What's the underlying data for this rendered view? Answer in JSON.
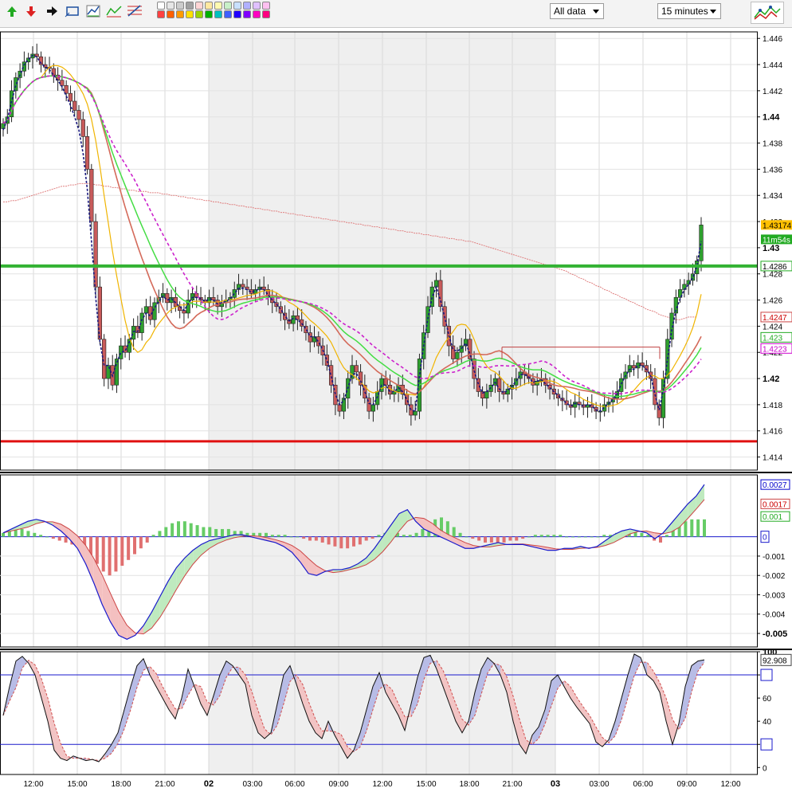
{
  "toolbar": {
    "range_select": "All data",
    "interval_select": "15 minutes",
    "swatch_colors": [
      "#ffffff",
      "#e6e6e6",
      "#cccccc",
      "#a0a0a0",
      "#ffd5d5",
      "#ffe8a0",
      "#fffab0",
      "#c8f0c8",
      "#c8e0ff",
      "#b0b0ff",
      "#e0c0ff",
      "#ffc0f0",
      "#ff4040",
      "#ff6000",
      "#ff9a00",
      "#ffe000",
      "#9ad400",
      "#00b000",
      "#00c0c0",
      "#4060ff",
      "#2000ff",
      "#8000ff",
      "#ff00c0",
      "#ff0080"
    ]
  },
  "chart_data": {
    "type": "candlestick",
    "x_ticks": [
      "12:00",
      "15:00",
      "18:00",
      "21:00",
      "02",
      "03:00",
      "06:00",
      "09:00",
      "12:00",
      "15:00",
      "18:00",
      "21:00",
      "03",
      "03:00",
      "06:00",
      "09:00",
      "12:00"
    ],
    "price": {
      "ylim": [
        1.413,
        1.4465
      ],
      "ticks": [
        "1.446",
        "1.444",
        "1.442",
        "1.44",
        "1.438",
        "1.436",
        "1.434",
        "1.432",
        "1.43",
        "1.428",
        "1.426",
        "1.424",
        "1.422",
        "1.42",
        "1.418",
        "1.416",
        "1.414"
      ],
      "bold_ticks": [
        "1.44",
        "1.43",
        "1.42"
      ],
      "close": [
        1.4395,
        1.44,
        1.442,
        1.443,
        1.4435,
        1.4442,
        1.4445,
        1.4448,
        1.4446,
        1.444,
        1.4438,
        1.4437,
        1.4432,
        1.4428,
        1.4424,
        1.4418,
        1.4412,
        1.4405,
        1.4398,
        1.4385,
        1.436,
        1.432,
        1.427,
        1.423,
        1.42,
        1.421,
        1.4195,
        1.4215,
        1.4225,
        1.422,
        1.423,
        1.424,
        1.4235,
        1.425,
        1.4255,
        1.4245,
        1.4258,
        1.4262,
        1.4265,
        1.4258,
        1.4262,
        1.4255,
        1.4252,
        1.425,
        1.426,
        1.4265,
        1.4262,
        1.426,
        1.4258,
        1.4262,
        1.426,
        1.4255,
        1.4258,
        1.426,
        1.4262,
        1.4268,
        1.4272,
        1.427,
        1.4268,
        1.4265,
        1.4268,
        1.427,
        1.4268,
        1.4262,
        1.4258,
        1.4255,
        1.425,
        1.4245,
        1.4242,
        1.4248,
        1.4245,
        1.424,
        1.4235,
        1.4228,
        1.4232,
        1.4225,
        1.4218,
        1.421,
        1.4195,
        1.418,
        1.4175,
        1.4185,
        1.42,
        1.421,
        1.4205,
        1.4195,
        1.4185,
        1.4175,
        1.418,
        1.419,
        1.42,
        1.4195,
        1.4188,
        1.419,
        1.4195,
        1.4188,
        1.418,
        1.4172,
        1.4175,
        1.4215,
        1.4235,
        1.4255,
        1.427,
        1.4275,
        1.4255,
        1.424,
        1.4225,
        1.4215,
        1.422,
        1.4225,
        1.423,
        1.4215,
        1.42,
        1.419,
        1.4185,
        1.419,
        1.4195,
        1.42,
        1.419,
        1.4188,
        1.4192,
        1.4195,
        1.42,
        1.4205,
        1.4203,
        1.42,
        1.4195,
        1.4198,
        1.42,
        1.4195,
        1.4192,
        1.4188,
        1.4185,
        1.4183,
        1.418,
        1.4178,
        1.4182,
        1.418,
        1.4178,
        1.418,
        1.4178,
        1.4175,
        1.4175,
        1.418,
        1.4182,
        1.4185,
        1.419,
        1.42,
        1.4205,
        1.421,
        1.4208,
        1.4212,
        1.421,
        1.4205,
        1.42,
        1.418,
        1.417,
        1.42,
        1.423,
        1.425,
        1.4262,
        1.4268,
        1.4272,
        1.4275,
        1.428,
        1.429,
        1.43174
      ],
      "ema_fast": [
        1.439,
        1.4398,
        1.4412,
        1.4424,
        1.4432,
        1.444,
        1.4444,
        1.4447,
        1.4446,
        1.4441,
        1.4438,
        1.4436,
        1.4432,
        1.4428,
        1.4423,
        1.4416,
        1.4409,
        1.44,
        1.439,
        1.4372,
        1.4345,
        1.4305,
        1.4262,
        1.4228,
        1.421,
        1.421,
        1.4202,
        1.4212,
        1.422,
        1.4221,
        1.4228,
        1.4236,
        1.4236,
        1.4245,
        1.425,
        1.4248,
        1.4254,
        1.4259,
        1.4263,
        1.426,
        1.4261,
        1.4258,
        1.4255,
        1.4252,
        1.4257,
        1.4262,
        1.4262,
        1.4261,
        1.4259,
        1.4261,
        1.426,
        1.4257,
        1.4258,
        1.4259,
        1.4261,
        1.4265,
        1.4269,
        1.4269,
        1.4268,
        1.4266,
        1.4267,
        1.4269,
        1.4268,
        1.4264,
        1.426,
        1.4257,
        1.4253,
        1.4248,
        1.4244,
        1.4246,
        1.4245,
        1.4242,
        1.4238,
        1.4232,
        1.4232,
        1.4228,
        1.4222,
        1.4214,
        1.4202,
        1.4188,
        1.418,
        1.4183,
        1.4193,
        1.4203,
        1.4204,
        1.4198,
        1.419,
        1.4181,
        1.418,
        1.4186,
        1.4195,
        1.4195,
        1.419,
        1.419,
        1.4193,
        1.419,
        1.4184,
        1.4176,
        1.4175,
        1.4202,
        1.4225,
        1.4246,
        1.4262,
        1.427,
        1.426,
        1.4247,
        1.4233,
        1.4222,
        1.4221,
        1.4223,
        1.4227,
        1.4219,
        1.4206,
        1.4196,
        1.4189,
        1.419,
        1.4193,
        1.4197,
        1.4192,
        1.4189,
        1.4191,
        1.4194,
        1.4198,
        1.4203,
        1.4203,
        1.4201,
        1.4197,
        1.4198,
        1.4199,
        1.4196,
        1.4193,
        1.419,
        1.4187,
        1.4184,
        1.4181,
        1.4179,
        1.4181,
        1.418,
        1.4179,
        1.418,
        1.4179,
        1.4176,
        1.4175,
        1.4178,
        1.4181,
        1.4184,
        1.4188,
        1.4196,
        1.4202,
        1.4207,
        1.4207,
        1.421,
        1.421,
        1.4207,
        1.4202,
        1.4188,
        1.4176,
        1.4191,
        1.4215,
        1.4237,
        1.4252,
        1.4261,
        1.4268,
        1.4272,
        1.4277,
        1.4286,
        1.4305
      ],
      "sma_long": [
        1.4335,
        1.4335,
        1.4336,
        1.4336,
        1.4337,
        1.4338,
        1.4339,
        1.434,
        1.4341,
        1.4342,
        1.4343,
        1.4344,
        1.4345,
        1.4346,
        1.4347,
        1.4347,
        1.4348,
        1.4348,
        1.4349,
        1.4349,
        1.4349,
        1.4349,
        1.4348,
        1.4348,
        1.4347,
        1.4347,
        1.4346,
        1.4346,
        1.4345,
        1.4345,
        1.4344,
        1.4344,
        1.4343,
        1.4343,
        1.4343,
        1.4342,
        1.4342,
        1.4342,
        1.4341,
        1.4341,
        1.434,
        1.434,
        1.4339,
        1.4339,
        1.4338,
        1.4338,
        1.4337,
        1.4337,
        1.4336,
        1.4336,
        1.4335,
        1.4335,
        1.4334,
        1.4334,
        1.4333,
        1.4333,
        1.4332,
        1.4332,
        1.4331,
        1.4331,
        1.433,
        1.433,
        1.4329,
        1.4329,
        1.4328,
        1.4328,
        1.4327,
        1.4327,
        1.4326,
        1.4326,
        1.4325,
        1.4325,
        1.4324,
        1.4324,
        1.4323,
        1.4323,
        1.4322,
        1.4322,
        1.4321,
        1.4321,
        1.432,
        1.432,
        1.4319,
        1.4319,
        1.4318,
        1.4318,
        1.4317,
        1.4317,
        1.4316,
        1.4316,
        1.4315,
        1.4315,
        1.4314,
        1.4314,
        1.4313,
        1.4313,
        1.4312,
        1.4312,
        1.4311,
        1.4311,
        1.431,
        1.431,
        1.4309,
        1.4309,
        1.4308,
        1.4308,
        1.4307,
        1.4307,
        1.4306,
        1.4306,
        1.4305,
        1.4305,
        1.4304,
        1.4303,
        1.4302,
        1.4301,
        1.43,
        1.4299,
        1.4298,
        1.4297,
        1.4296,
        1.4295,
        1.4294,
        1.4293,
        1.4292,
        1.4291,
        1.429,
        1.4289,
        1.4288,
        1.4287,
        1.4286,
        1.4285,
        1.4284,
        1.4283,
        1.4282,
        1.428,
        1.4279,
        1.4277,
        1.4276,
        1.4274,
        1.4273,
        1.4271,
        1.427,
        1.4268,
        1.4267,
        1.4265,
        1.4264,
        1.4262,
        1.4261,
        1.4259,
        1.4258,
        1.4256,
        1.4255,
        1.4253,
        1.4252,
        1.4251,
        1.4249,
        1.4248,
        1.4247,
        1.4246,
        1.4245,
        1.4245,
        1.4246,
        1.4247,
        1.4247,
        1.4247
      ],
      "support_level": 1.4152,
      "resistance_level": 1.4286,
      "price_tags": [
        {
          "label": "1.43174",
          "bg": "#ffc000",
          "fg": "#000000",
          "v": 1.43174
        },
        {
          "label": "11m54s",
          "bg": "#22aa22",
          "fg": "#ffffff",
          "v": 1.43064
        },
        {
          "label": "1.4286",
          "bg": "#ffffff",
          "fg": "#000000",
          "border": "#22aa22",
          "v": 1.4286
        },
        {
          "label": "1.4247",
          "bg": "#ffffff",
          "fg": "#cc0000",
          "border": "#cc4444",
          "v": 1.4247
        },
        {
          "label": "1.423",
          "bg": "#ffffff",
          "fg": "#22aa22",
          "border": "#22aa22",
          "v": 1.42315
        },
        {
          "label": "1.4223",
          "bg": "#ffffff",
          "fg": "#cc00cc",
          "border": "#cc00cc",
          "v": 1.4223
        }
      ]
    },
    "macd": {
      "ylim": [
        -0.0057,
        0.0032
      ],
      "ticks": [
        "-0.001",
        "-0.002",
        "-0.003",
        "-0.004",
        "-0.005"
      ],
      "bold_ticks": [
        "-0.005"
      ],
      "zero_label": "0",
      "tags": [
        {
          "label": "0.0027",
          "fg": "#0000cc",
          "border": "#0000cc",
          "v": 0.0027
        },
        {
          "label": "0.0017",
          "fg": "#cc0000",
          "border": "#cc4444",
          "v": 0.0017
        },
        {
          "label": "0.001",
          "fg": "#22aa22",
          "border": "#22aa22",
          "v": 0.00105
        }
      ],
      "hist": [
        0.0002,
        0.0003,
        0.0004,
        0.0004,
        0.0003,
        0.0002,
        0.0001,
        0,
        -0.0001,
        -0.0002,
        -0.0003,
        -0.0004,
        -0.0005,
        -0.0007,
        -0.001,
        -0.0014,
        -0.0018,
        -0.002,
        -0.0018,
        -0.0015,
        -0.0012,
        -0.0009,
        -0.0006,
        -0.0003,
        0.0001,
        0.0003,
        0.0005,
        0.0007,
        0.0008,
        0.0008,
        0.0007,
        0.0006,
        0.0005,
        0.0005,
        0.0004,
        0.0004,
        0.0004,
        0.0003,
        0.0003,
        0.0002,
        0.0002,
        0.0002,
        0.0002,
        0.0001,
        0.0001,
        0.0001,
        0,
        0,
        -0.0001,
        -0.0002,
        -0.0002,
        -0.0003,
        -0.0004,
        -0.0005,
        -0.0006,
        -0.0006,
        -0.0005,
        -0.0004,
        -0.0002,
        -0.0001,
        0.0001,
        0.0002,
        0.0002,
        0.0002,
        0.0001,
        0.0001,
        0.0002,
        0.0004,
        0.0007,
        0.0009,
        0.001,
        0.0008,
        0.0005,
        0.0002,
        0,
        -0.0001,
        -0.0002,
        -0.0003,
        -0.0003,
        -0.0003,
        -0.0003,
        -0.0002,
        -0.0002,
        -0.0001,
        0,
        0.0001,
        0.0001,
        0.0001,
        0.0001,
        0.0001,
        0,
        0,
        0,
        0,
        0,
        0,
        0.0001,
        0.0001,
        0.0002,
        0.0003,
        0.0003,
        0.0003,
        0.0002,
        0.0001,
        -0.0002,
        -0.0003,
        0.0001,
        0.0004,
        0.0006,
        0.0008,
        0.0009,
        0.0009,
        0.0009
      ],
      "macd_line": [
        0.0002,
        0.0004,
        0.0006,
        0.0008,
        0.0009,
        0.0008,
        0.0006,
        0.0003,
        -0.0001,
        -0.0006,
        -0.0014,
        -0.0024,
        -0.0035,
        -0.0044,
        -0.0051,
        -0.0053,
        -0.0051,
        -0.0046,
        -0.0039,
        -0.0031,
        -0.0023,
        -0.0016,
        -0.0011,
        -0.0007,
        -0.0004,
        -0.0002,
        -0.0001,
        0,
        0.0001,
        0.0001,
        0,
        -0.0001,
        -0.0002,
        -0.0003,
        -0.0005,
        -0.0008,
        -0.0013,
        -0.0019,
        -0.002,
        -0.0018,
        -0.0017,
        -0.0017,
        -0.0016,
        -0.0014,
        -0.0011,
        -0.0006,
        0,
        0.0006,
        0.0012,
        0.0014,
        0.0008,
        0.0004,
        0.0002,
        0,
        -0.0002,
        -0.0004,
        -0.0006,
        -0.0006,
        -0.0005,
        -0.0004,
        -0.0003,
        -0.0004,
        -0.0004,
        -0.0004,
        -0.0005,
        -0.0006,
        -0.0007,
        -0.0007,
        -0.0006,
        -0.0006,
        -0.0005,
        -0.0006,
        -0.0005,
        -0.0002,
        0.0001,
        0.0003,
        0.0004,
        0.0003,
        0.0002,
        -0.0001,
        0.0002,
        0.0007,
        0.0012,
        0.0017,
        0.0021,
        0.0027
      ]
    },
    "stoch": {
      "ylim": [
        -6,
        100
      ],
      "ticks": [
        "100",
        "80",
        "60",
        "40",
        "20",
        "0"
      ],
      "bold_ticks": [
        "100"
      ],
      "upper": 80,
      "lower": 20,
      "tag": {
        "label": "92.908",
        "v": 92.908
      },
      "k": [
        45,
        70,
        92,
        96,
        90,
        80,
        60,
        40,
        15,
        8,
        6,
        10,
        8,
        6,
        7,
        5,
        12,
        20,
        30,
        50,
        70,
        88,
        94,
        80,
        70,
        60,
        50,
        42,
        60,
        85,
        70,
        55,
        45,
        62,
        80,
        92,
        88,
        80,
        72,
        45,
        30,
        25,
        30,
        55,
        80,
        88,
        72,
        55,
        40,
        30,
        25,
        40,
        28,
        18,
        8,
        15,
        30,
        50,
        70,
        82,
        65,
        55,
        45,
        32,
        55,
        78,
        95,
        97,
        85,
        70,
        55,
        40,
        30,
        40,
        65,
        85,
        95,
        90,
        80,
        65,
        40,
        20,
        12,
        28,
        35,
        50,
        75,
        80,
        70,
        60,
        52,
        45,
        38,
        22,
        18,
        24,
        40,
        60,
        80,
        98,
        95,
        80,
        75,
        65,
        40,
        20,
        38,
        70,
        88,
        92,
        93
      ]
    }
  }
}
